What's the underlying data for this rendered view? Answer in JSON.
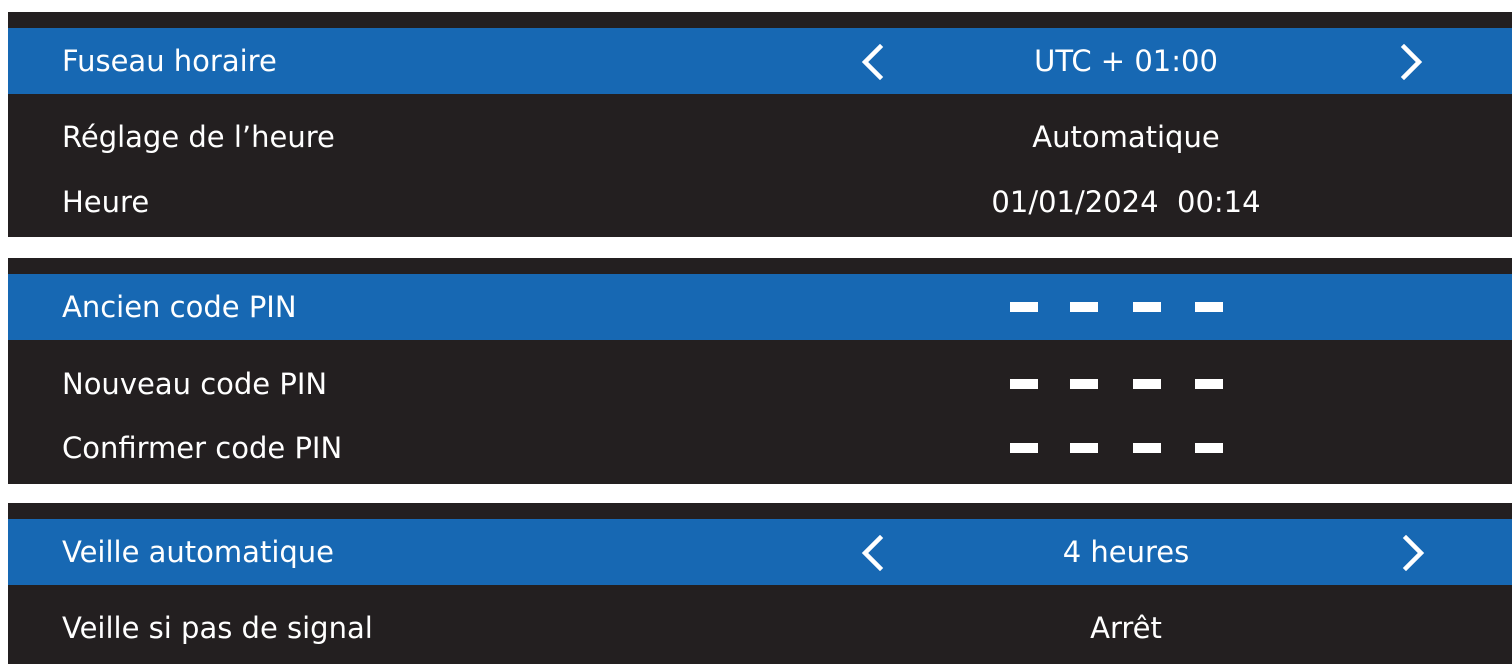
{
  "colors": {
    "panel_background": "#231f20",
    "selected_row": "#1768b3",
    "text": "#ffffff",
    "page_background": "#ffffff"
  },
  "time_settings": {
    "timezone": {
      "label": "Fuseau horaire",
      "value": "UTC + 01:00",
      "selected": true,
      "left_arrow_icon": "chevron-left-icon",
      "right_arrow_icon": "chevron-right-icon"
    },
    "clock_mode": {
      "label": "Réglage de l’heure",
      "value": "Automatique"
    },
    "clock": {
      "label": "Heure",
      "value": "01/01/2024  00:14"
    }
  },
  "pin_settings": {
    "old_pin": {
      "label": "Ancien code PIN",
      "digits_entered": 0,
      "digits_total": 4,
      "selected": true
    },
    "new_pin": {
      "label": "Nouveau code PIN",
      "digits_entered": 0,
      "digits_total": 4
    },
    "confirm_pin": {
      "label": "Confirmer code PIN",
      "digits_entered": 0,
      "digits_total": 4
    }
  },
  "sleep_settings": {
    "auto_sleep": {
      "label": "Veille automatique",
      "value": "4 heures",
      "selected": true,
      "left_arrow_icon": "chevron-left-icon",
      "right_arrow_icon": "chevron-right-icon"
    },
    "no_signal_sleep": {
      "label": "Veille si pas de signal",
      "value": "Arrêt"
    }
  }
}
